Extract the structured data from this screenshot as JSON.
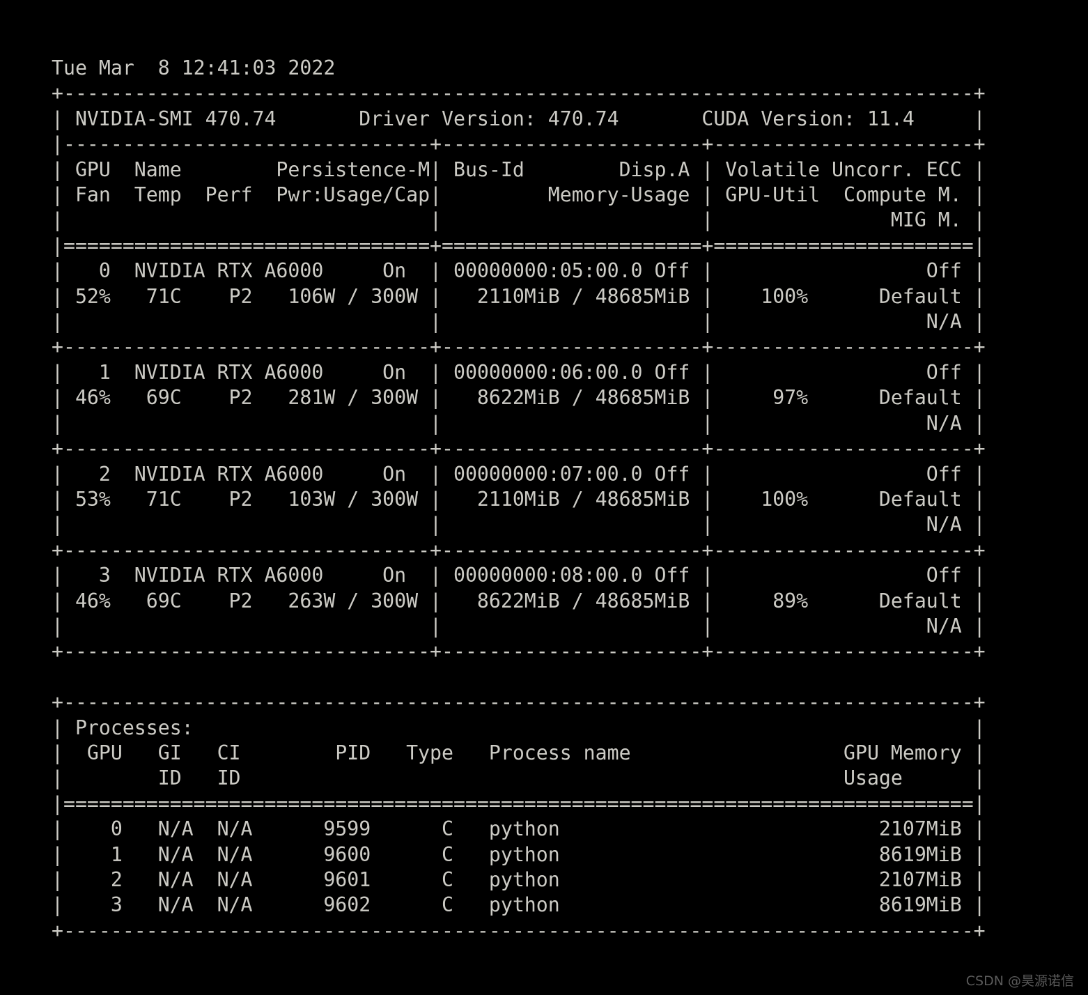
{
  "terminal": {
    "background_color": "#000000",
    "text_color": "#cccbc5",
    "timestamp": "Tue Mar  8 12:41:03 2022",
    "header": {
      "smi_label": "NVIDIA-SMI",
      "smi_version": "470.74",
      "driver_label": "Driver Version:",
      "driver_version": "470.74",
      "cuda_label": "CUDA Version:",
      "cuda_version": "11.4"
    },
    "gpu_table": {
      "headers_line1": [
        "GPU",
        "Name",
        "Persistence-M",
        "Bus-Id",
        "Disp.A",
        "Volatile Uncorr. ECC"
      ],
      "headers_line2": [
        "Fan",
        "Temp",
        "Perf",
        "Pwr:Usage/Cap",
        "Memory-Usage",
        "GPU-Util",
        "Compute M."
      ],
      "headers_line3": [
        "MIG M."
      ],
      "rows": [
        {
          "index": "0",
          "name": "NVIDIA RTX A6000",
          "persistence_m": "On",
          "bus_id": "00000000:05:00.0",
          "disp_a": "Off",
          "uncorr_ecc": "Off",
          "fan": "52%",
          "temp": "71C",
          "perf": "P2",
          "pwr_usage": "106W",
          "pwr_cap": "300W",
          "memory_used": "2110MiB",
          "memory_total": "48685MiB",
          "gpu_util": "100%",
          "compute_m": "Default",
          "mig_m": "N/A"
        },
        {
          "index": "1",
          "name": "NVIDIA RTX A6000",
          "persistence_m": "On",
          "bus_id": "00000000:06:00.0",
          "disp_a": "Off",
          "uncorr_ecc": "Off",
          "fan": "46%",
          "temp": "69C",
          "perf": "P2",
          "pwr_usage": "281W",
          "pwr_cap": "300W",
          "memory_used": "8622MiB",
          "memory_total": "48685MiB",
          "gpu_util": "97%",
          "compute_m": "Default",
          "mig_m": "N/A"
        },
        {
          "index": "2",
          "name": "NVIDIA RTX A6000",
          "persistence_m": "On",
          "bus_id": "00000000:07:00.0",
          "disp_a": "Off",
          "uncorr_ecc": "Off",
          "fan": "53%",
          "temp": "71C",
          "perf": "P2",
          "pwr_usage": "103W",
          "pwr_cap": "300W",
          "memory_used": "2110MiB",
          "memory_total": "48685MiB",
          "gpu_util": "100%",
          "compute_m": "Default",
          "mig_m": "N/A"
        },
        {
          "index": "3",
          "name": "NVIDIA RTX A6000",
          "persistence_m": "On",
          "bus_id": "00000000:08:00.0",
          "disp_a": "Off",
          "uncorr_ecc": "Off",
          "fan": "46%",
          "temp": "69C",
          "perf": "P2",
          "pwr_usage": "263W",
          "pwr_cap": "300W",
          "memory_used": "8622MiB",
          "memory_total": "48685MiB",
          "gpu_util": "89%",
          "compute_m": "Default",
          "mig_m": "N/A"
        }
      ]
    },
    "processes_table": {
      "title": "Processes:",
      "headers_line1": [
        "GPU",
        "GI",
        "CI",
        "PID",
        "Type",
        "Process name",
        "GPU Memory"
      ],
      "headers_line2": [
        "ID",
        "ID",
        "Usage"
      ],
      "rows": [
        {
          "gpu": "0",
          "gi_id": "N/A",
          "ci_id": "N/A",
          "pid": "9599",
          "type": "C",
          "process_name": "python",
          "gpu_memory_usage": "2107MiB"
        },
        {
          "gpu": "1",
          "gi_id": "N/A",
          "ci_id": "N/A",
          "pid": "9600",
          "type": "C",
          "process_name": "python",
          "gpu_memory_usage": "8619MiB"
        },
        {
          "gpu": "2",
          "gi_id": "N/A",
          "ci_id": "N/A",
          "pid": "9601",
          "type": "C",
          "process_name": "python",
          "gpu_memory_usage": "2107MiB"
        },
        {
          "gpu": "3",
          "gi_id": "N/A",
          "ci_id": "N/A",
          "pid": "9602",
          "type": "C",
          "process_name": "python",
          "gpu_memory_usage": "8619MiB"
        }
      ]
    },
    "full_output": "Tue Mar  8 12:41:03 2022\n+-----------------------------------------------------------------------------+\n| NVIDIA-SMI 470.74       Driver Version: 470.74       CUDA Version: 11.4     |\n|-------------------------------+----------------------+----------------------+\n| GPU  Name        Persistence-M| Bus-Id        Disp.A | Volatile Uncorr. ECC |\n| Fan  Temp  Perf  Pwr:Usage/Cap|         Memory-Usage | GPU-Util  Compute M. |\n|                               |                      |               MIG M. |\n|===============================+======================+======================|\n|   0  NVIDIA RTX A6000     On  | 00000000:05:00.0 Off |                  Off |\n| 52%   71C    P2   106W / 300W |   2110MiB / 48685MiB |    100%      Default |\n|                               |                      |                  N/A |\n+-------------------------------+----------------------+----------------------+\n|   1  NVIDIA RTX A6000     On  | 00000000:06:00.0 Off |                  Off |\n| 46%   69C    P2   281W / 300W |   8622MiB / 48685MiB |     97%      Default |\n|                               |                      |                  N/A |\n+-------------------------------+----------------------+----------------------+\n|   2  NVIDIA RTX A6000     On  | 00000000:07:00.0 Off |                  Off |\n| 53%   71C    P2   103W / 300W |   2110MiB / 48685MiB |    100%      Default |\n|                               |                      |                  N/A |\n+-------------------------------+----------------------+----------------------+\n|   3  NVIDIA RTX A6000     On  | 00000000:08:00.0 Off |                  Off |\n| 46%   69C    P2   263W / 300W |   8622MiB / 48685MiB |     89%      Default |\n|                               |                      |                  N/A |\n+-------------------------------+----------------------+----------------------+\n                                                                               \n+-----------------------------------------------------------------------------+\n| Processes:                                                                  |\n|  GPU   GI   CI        PID   Type   Process name                  GPU Memory |\n|        ID   ID                                                   Usage      |\n|=============================================================================|\n|    0   N/A  N/A      9599      C   python                           2107MiB |\n|    1   N/A  N/A      9600      C   python                           8619MiB |\n|    2   N/A  N/A      9601      C   python                           2107MiB |\n|    3   N/A  N/A      9602      C   python                           8619MiB |\n+-----------------------------------------------------------------------------+"
  },
  "watermark": {
    "text": "CSDN @昊源诺信",
    "color": "#5a5a5a"
  }
}
